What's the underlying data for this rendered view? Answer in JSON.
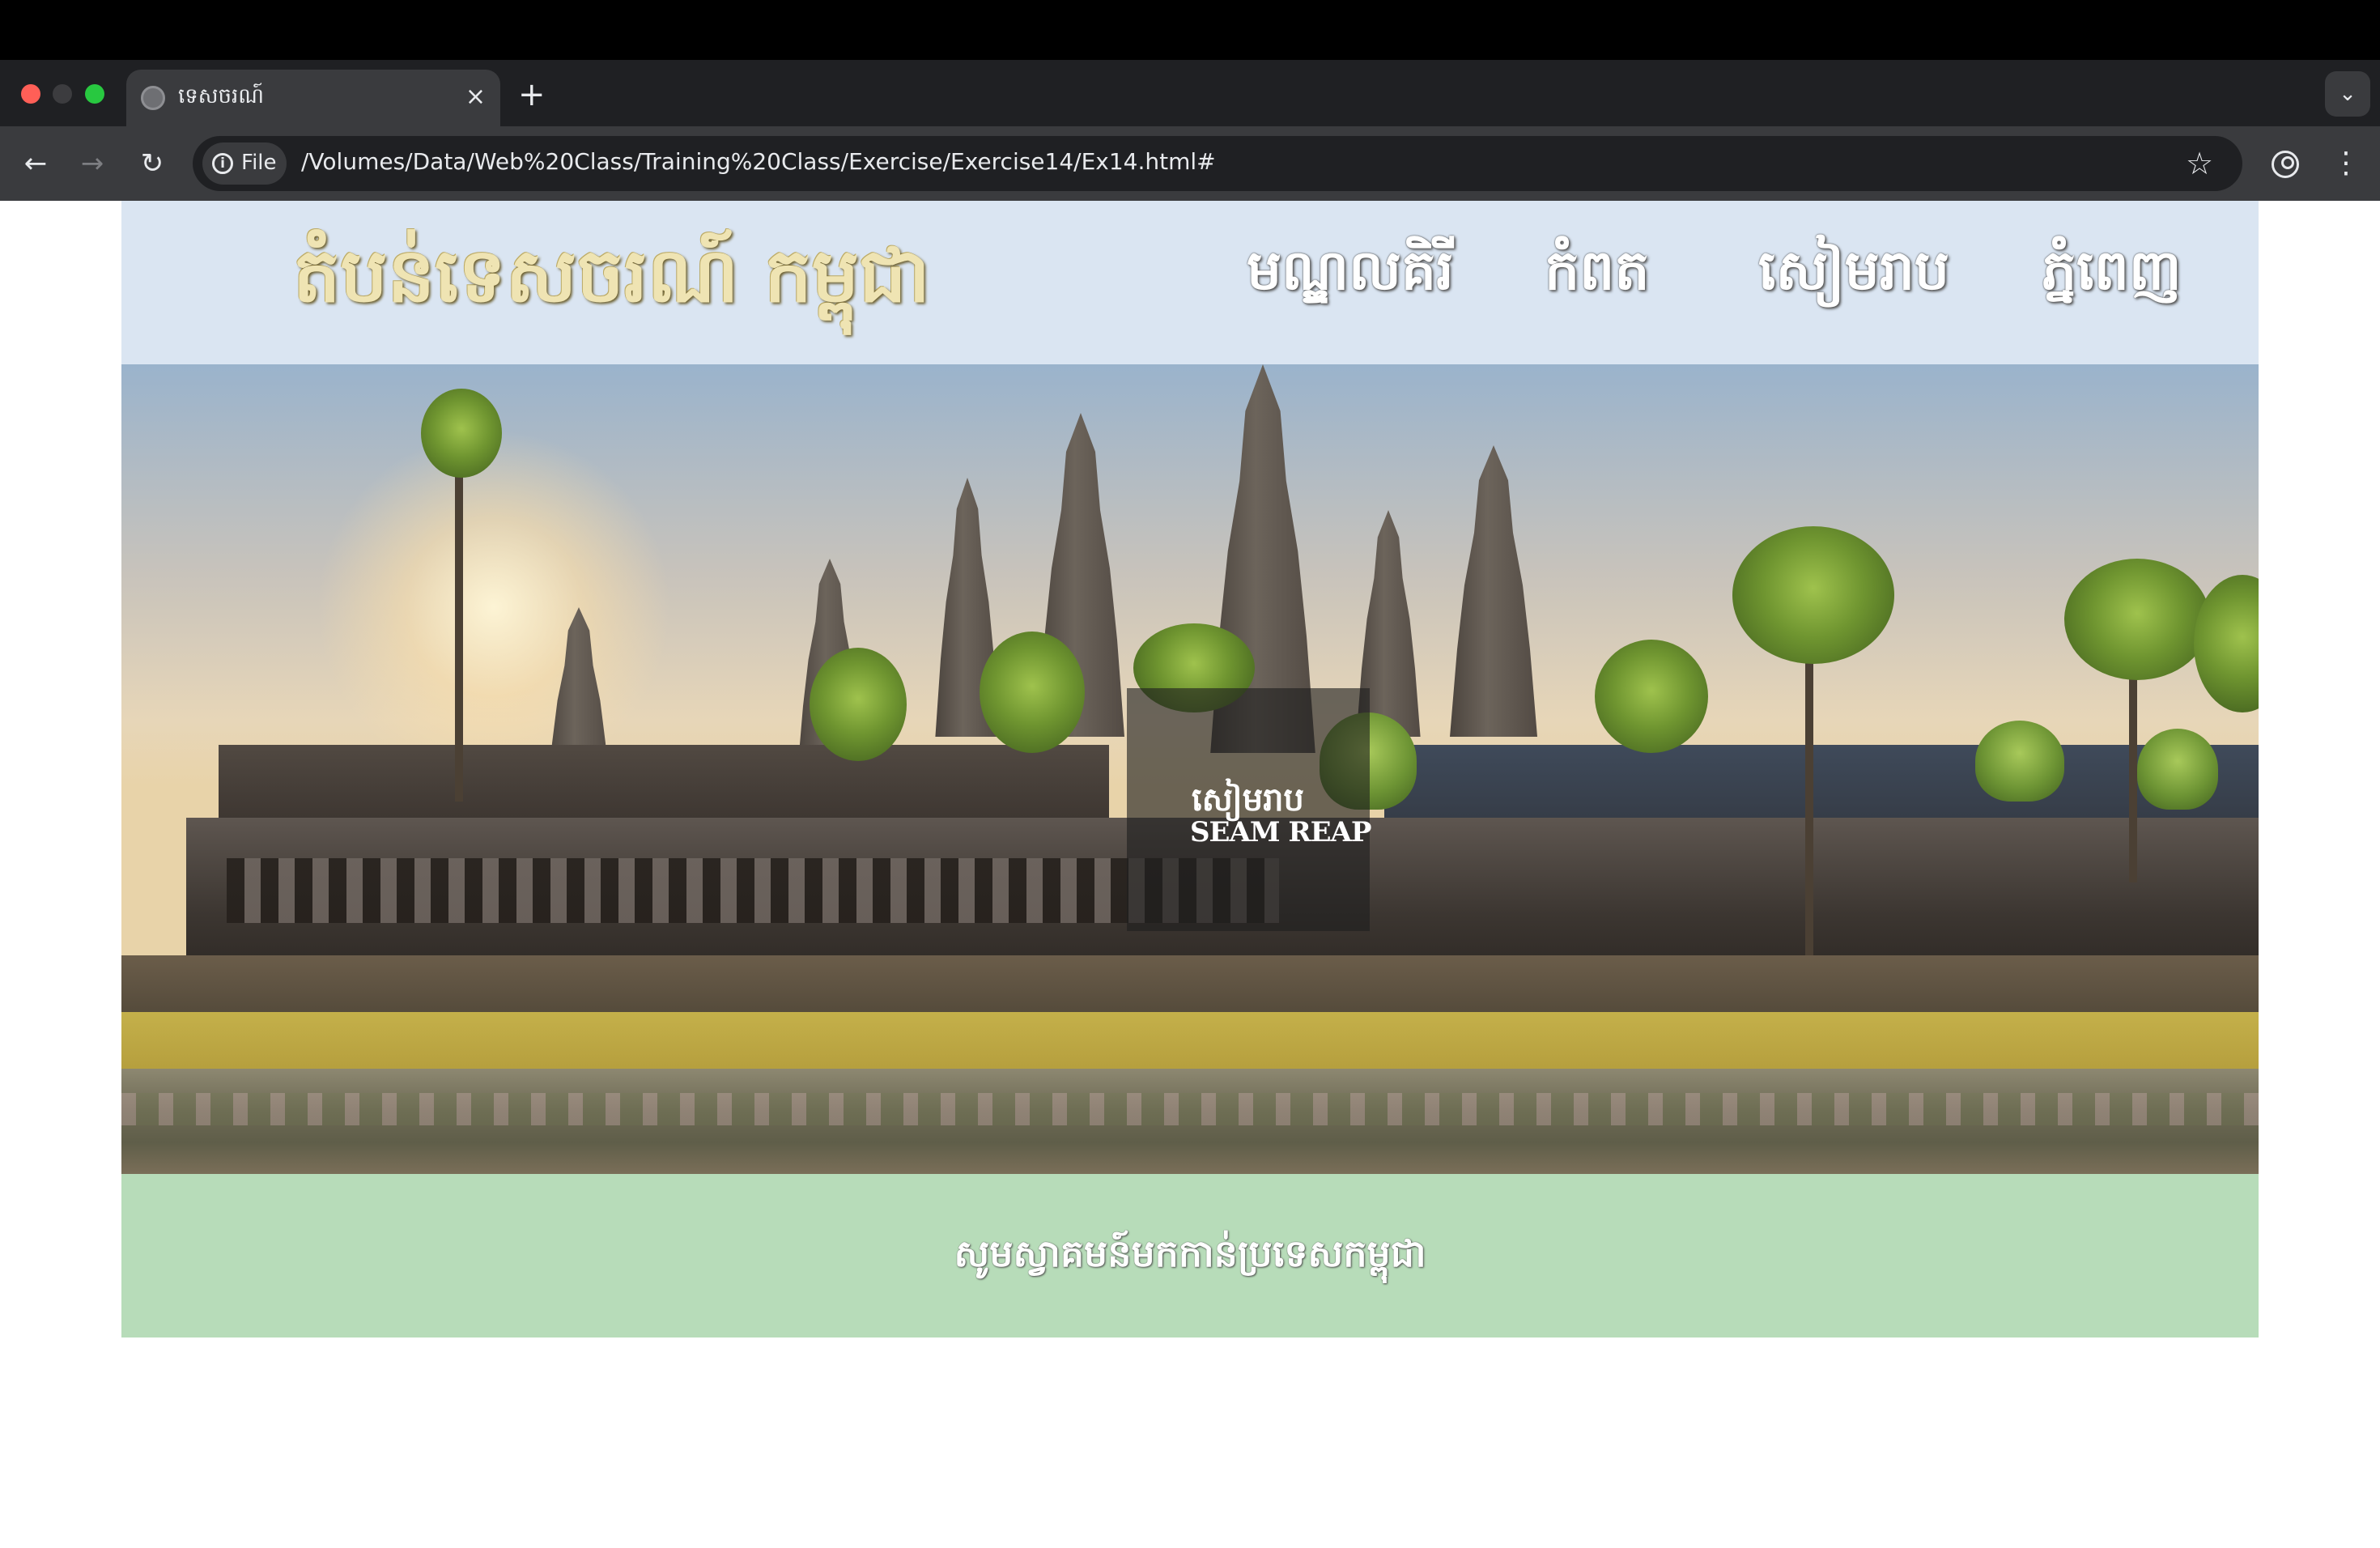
{
  "browser": {
    "tab": {
      "title": "ទេសចរណ៍",
      "close_glyph": "×"
    },
    "new_tab_glyph": "+",
    "tab_dropdown_glyph": "⌄",
    "nav": {
      "back_glyph": "←",
      "forward_glyph": "→",
      "reload_glyph": "↻"
    },
    "address_bar": {
      "chip_label": "File",
      "info_glyph": "i",
      "url": "/Volumes/Data/Web%20Class/Training%20Class/Exercise/Exercise14/Ex14.html#"
    },
    "bookmark_glyph": "☆",
    "menu_glyph": "⋮"
  },
  "site": {
    "logo": "តំបន់ទេសចរណ៍ កម្ពុជា",
    "nav": [
      {
        "label": "មណ្ឌលគិរី"
      },
      {
        "label": "កំពត"
      },
      {
        "label": "សៀមរាប"
      },
      {
        "label": "ភ្នំពេញ"
      }
    ],
    "hero": {
      "caption_kh": "សៀមរាប",
      "caption_en": "SEAM REAP"
    },
    "footer": {
      "text": "សូមស្វាគមន៍មកកាន់ប្រទេសកម្ពុជា"
    },
    "colors": {
      "header_bg": "#dae5f2",
      "footer_bg": "#b7dcb9",
      "logo_color": "#efe4b3"
    }
  }
}
